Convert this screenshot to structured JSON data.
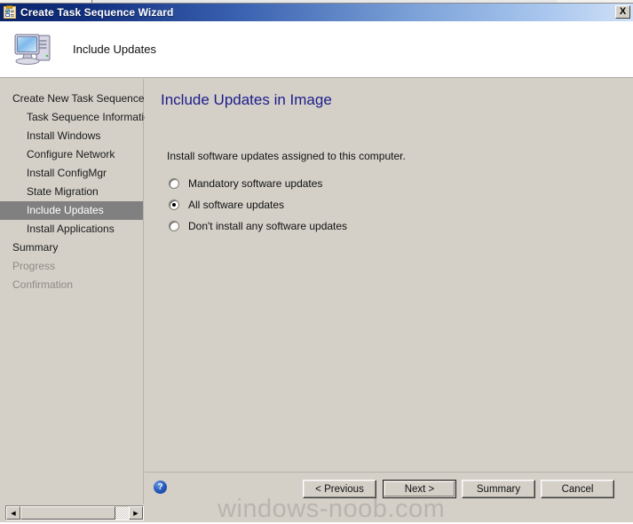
{
  "window": {
    "title": "Create Task Sequence Wizard",
    "title_icon": "task-sequence-icon",
    "close_label": "X"
  },
  "header": {
    "icon": "computer-icon",
    "title": "Include Updates"
  },
  "sidebar": {
    "items": [
      {
        "label": "Create New Task Sequence",
        "level": 0,
        "state": "normal"
      },
      {
        "label": "Task Sequence Information",
        "level": 1,
        "state": "normal"
      },
      {
        "label": "Install Windows",
        "level": 1,
        "state": "normal"
      },
      {
        "label": "Configure Network",
        "level": 1,
        "state": "normal"
      },
      {
        "label": "Install ConfigMgr",
        "level": 1,
        "state": "normal"
      },
      {
        "label": "State Migration",
        "level": 1,
        "state": "normal"
      },
      {
        "label": "Include Updates",
        "level": 1,
        "state": "selected"
      },
      {
        "label": "Install Applications",
        "level": 1,
        "state": "normal"
      },
      {
        "label": "Summary",
        "level": 0,
        "state": "normal"
      },
      {
        "label": "Progress",
        "level": 0,
        "state": "disabled"
      },
      {
        "label": "Confirmation",
        "level": 0,
        "state": "disabled"
      }
    ]
  },
  "main": {
    "heading": "Include Updates in Image",
    "instruction": "Install software updates assigned to this computer.",
    "options": [
      {
        "label": "Mandatory software updates",
        "selected": false
      },
      {
        "label": "All software updates",
        "selected": true
      },
      {
        "label": "Don't install any software updates",
        "selected": false
      }
    ]
  },
  "footer": {
    "help_icon": "?",
    "previous_label": "< Previous",
    "next_label": "Next >",
    "summary_label": "Summary",
    "cancel_label": "Cancel"
  },
  "watermark": {
    "text": "windows-noob.com"
  },
  "scrollbar": {
    "left_arrow": "◀",
    "right_arrow": "▶"
  },
  "colors": {
    "face": "#d4d0c8",
    "heading": "#1c1c8c",
    "selection": "#808080",
    "titlebar_start": "#0a246a",
    "titlebar_end": "#cfe0f6"
  }
}
